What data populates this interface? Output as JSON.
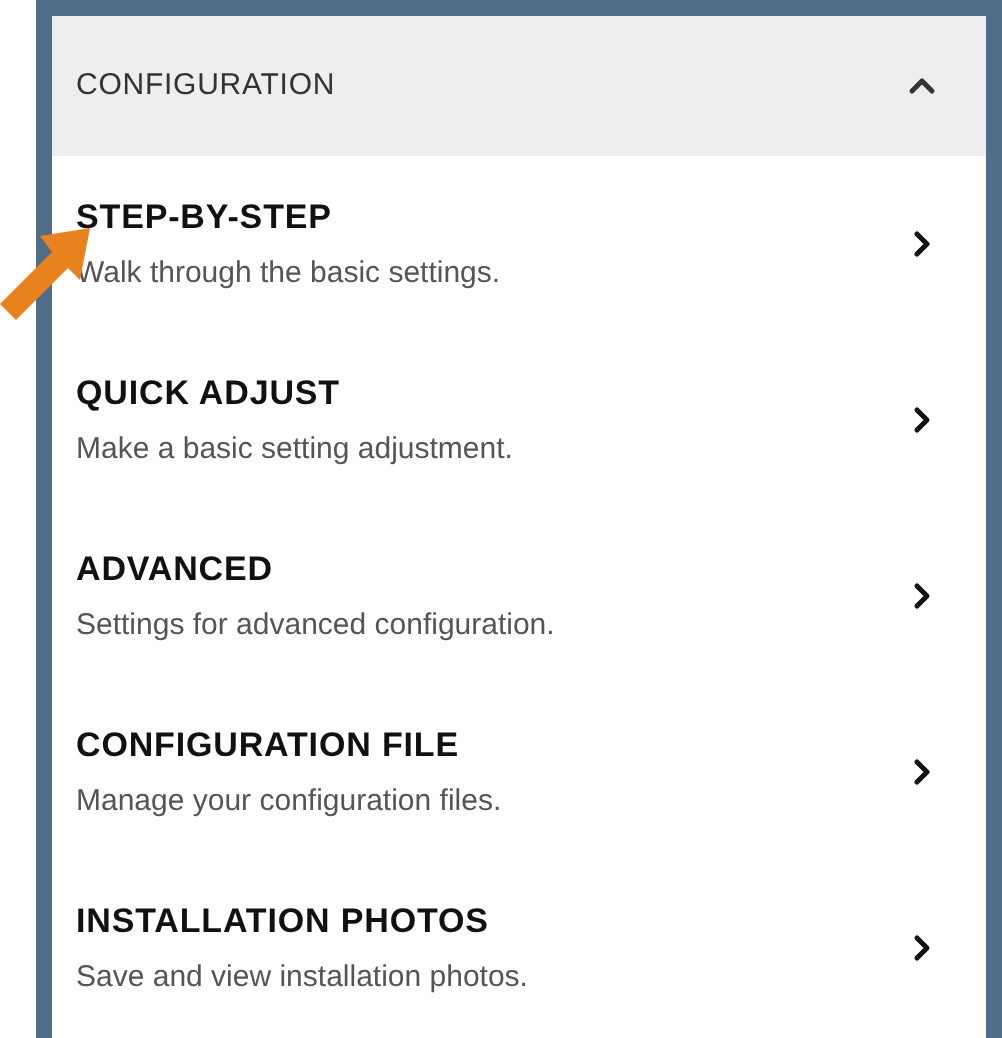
{
  "section": {
    "title": "CONFIGURATION",
    "expanded": true
  },
  "items": [
    {
      "title": "STEP-BY-STEP",
      "description": "Walk through the basic settings."
    },
    {
      "title": "QUICK ADJUST",
      "description": "Make a basic setting adjustment."
    },
    {
      "title": "ADVANCED",
      "description": "Settings for advanced configuration."
    },
    {
      "title": "CONFIGURATION FILE",
      "description": "Manage your configuration files."
    },
    {
      "title": "INSTALLATION PHOTOS",
      "description": "Save and view installation photos."
    }
  ]
}
